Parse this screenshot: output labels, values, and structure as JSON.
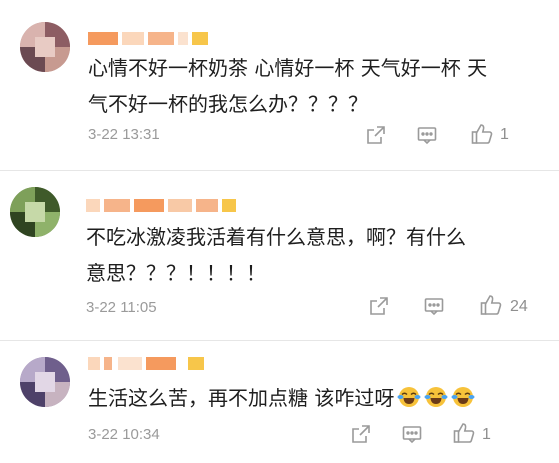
{
  "comments": [
    {
      "text_lines": [
        "心情不好一杯奶茶 心情好一杯 天气好一杯 天",
        "气不好一杯的我怎么办？？？？"
      ],
      "time": "3-22 13:31",
      "likes": "1"
    },
    {
      "text_lines": [
        "不吃冰激凌我活着有什么意思，啊？有什么",
        "意思？？？！！！！"
      ],
      "time": "3-22 11:05",
      "likes": "24"
    },
    {
      "text_lines": [
        "生活这么苦，再不加点糖 该咋过呀"
      ],
      "emoji": [
        "laughing-crying-emoji",
        "laughing-crying-emoji",
        "laughing-crying-emoji"
      ],
      "time": "3-22 10:34",
      "likes": "1"
    }
  ],
  "icons": {
    "share": "share-icon",
    "comment": "comment-icon",
    "like": "thumbs-up-icon"
  },
  "colors": {
    "name_orange": "#f59a5e",
    "name_yellow": "#f7c64a",
    "meta_gray": "#9a9a9a"
  }
}
